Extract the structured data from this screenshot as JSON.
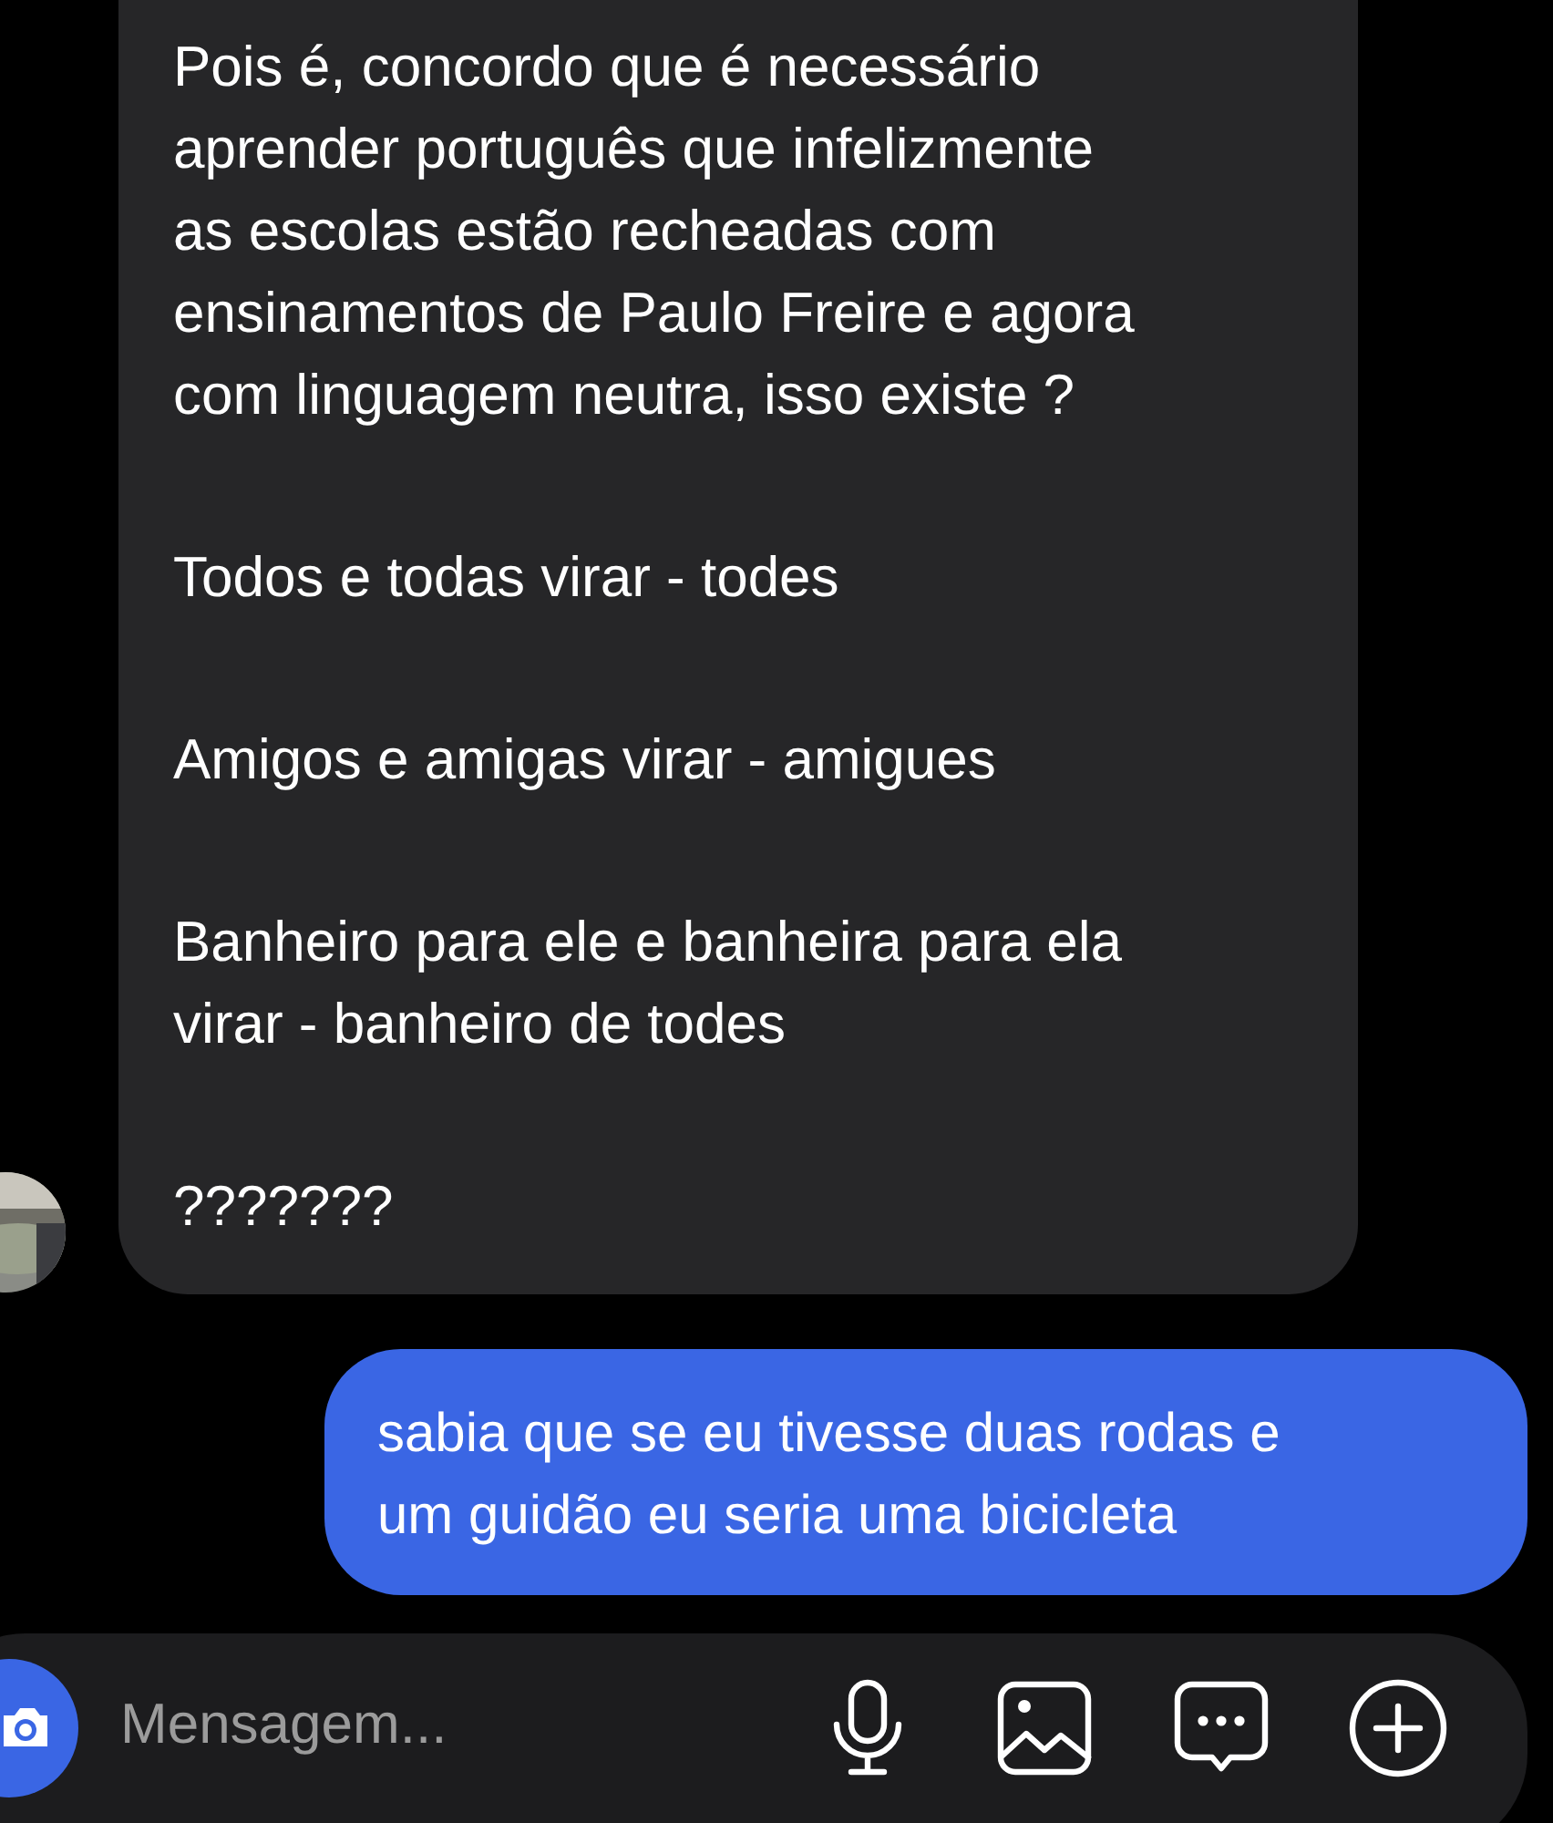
{
  "messages": [
    {
      "kind": "received",
      "paragraphs": [
        "Pois é, concordo que é necessário\naprender português que infelizmente\nas escolas estão recheadas com\nensinamentos de Paulo Freire e agora\ncom linguagem neutra, isso existe ?",
        "Todos e todas virar - todes",
        "Amigos e amigas virar - amigues",
        "Banheiro para ele e banheira para ela\nvirar - banheiro de todes",
        "???????"
      ]
    },
    {
      "kind": "sent",
      "paragraphs": [
        "sabia que se eu tivesse duas rodas e\num guidão eu seria uma bicicleta"
      ]
    }
  ],
  "composer": {
    "placeholder": "Mensagem..."
  }
}
